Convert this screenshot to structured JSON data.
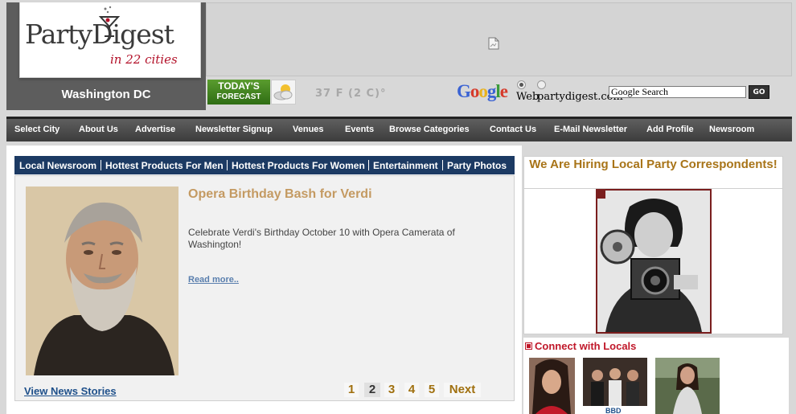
{
  "header": {
    "logo_main": "PartyDigest",
    "logo_tagline": "in 22 cities",
    "city": "Washington DC",
    "forecast_line1": "TODAY'S",
    "forecast_line2": "FORECAST",
    "temperature": "37 F (2 C)°",
    "search": {
      "brand": "Google",
      "option_web": "Web",
      "option_site": "partydigest.com",
      "selected_option": "Web",
      "input_value": "Google Search",
      "go_label": "GO"
    }
  },
  "nav": {
    "items": [
      "Select City",
      "About Us",
      "Advertise",
      "Newsletter Signup",
      "Venues",
      "Events",
      "Browse Categories",
      "Contact Us",
      "E-Mail Newsletter",
      "Add Profile",
      "Newsroom"
    ]
  },
  "tabs": [
    "Local Newsroom",
    "Hottest Products For Men",
    "Hottest Products For Women",
    "Entertainment",
    "Party Photos"
  ],
  "story": {
    "title": "Opera Birthday Bash for Verdi",
    "text": "Celebrate Verdi's Birthday October 10 with Opera Camerata of Washington!",
    "read_more": "Read more..",
    "view_all": "View News Stories"
  },
  "pagination": {
    "pages": [
      "1",
      "2",
      "3",
      "4",
      "5"
    ],
    "current": "2",
    "next_label": "Next"
  },
  "sidebar": {
    "hiring_title": "We Are Hiring Local Party Correspondents!",
    "connect_title": "Connect with Locals",
    "avatar_label": "BBD"
  },
  "colors": {
    "nav_bg": "#4a4a4a",
    "tab_bar": "#1c3a63",
    "story_title": "#c49a62",
    "accent_red": "#c0182a",
    "link_blue": "#1d4f8a"
  }
}
